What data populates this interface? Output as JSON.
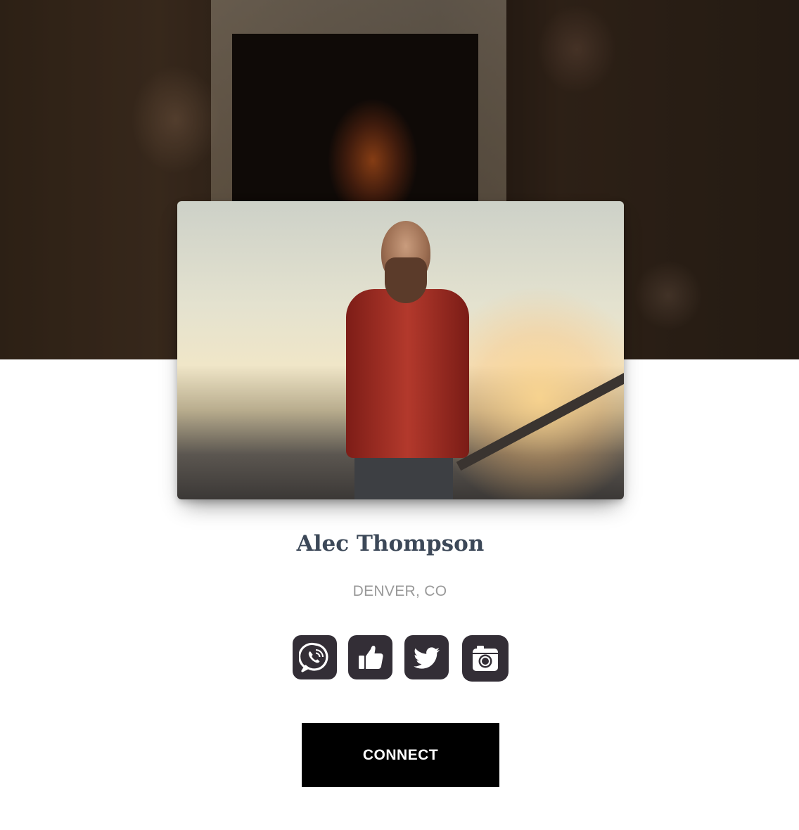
{
  "profile": {
    "name": "Alec Thompson",
    "location": "DENVER, CO"
  },
  "socials": [
    {
      "icon": "whatsapp-icon"
    },
    {
      "icon": "thumbs-up-icon"
    },
    {
      "icon": "twitter-icon"
    },
    {
      "icon": "camera-icon"
    }
  ],
  "actions": {
    "connect_label": "CONNECT"
  },
  "colors": {
    "name_text": "#3c4858",
    "location_text": "#999999",
    "icon_tile": "#332e36",
    "button_bg": "#000000",
    "button_text": "#ffffff"
  }
}
